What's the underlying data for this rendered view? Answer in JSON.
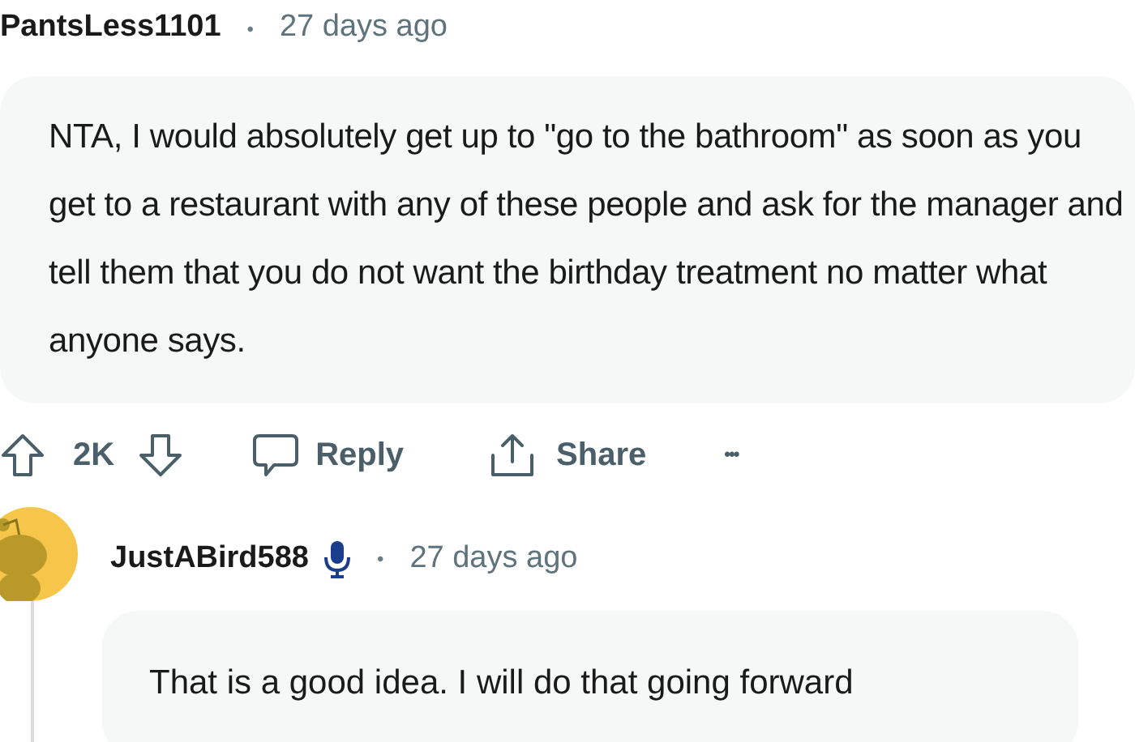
{
  "comment": {
    "author": "PantsLess1101",
    "separator": "•",
    "time": "27 days ago",
    "body": "NTA, I would absolutely get up to \"go to the bathroom\" as soon as you get to a restaurant with any of these people and ask for the manager and tell them that you do not want the birthday treatment no matter what anyone says.",
    "votes": "2K",
    "reply_label": "Reply",
    "share_label": "Share",
    "more_label": "•••"
  },
  "reply": {
    "author": "JustABird588",
    "separator": "•",
    "time": "27 days ago",
    "body": "That is a good idea. I will do that going forward"
  }
}
